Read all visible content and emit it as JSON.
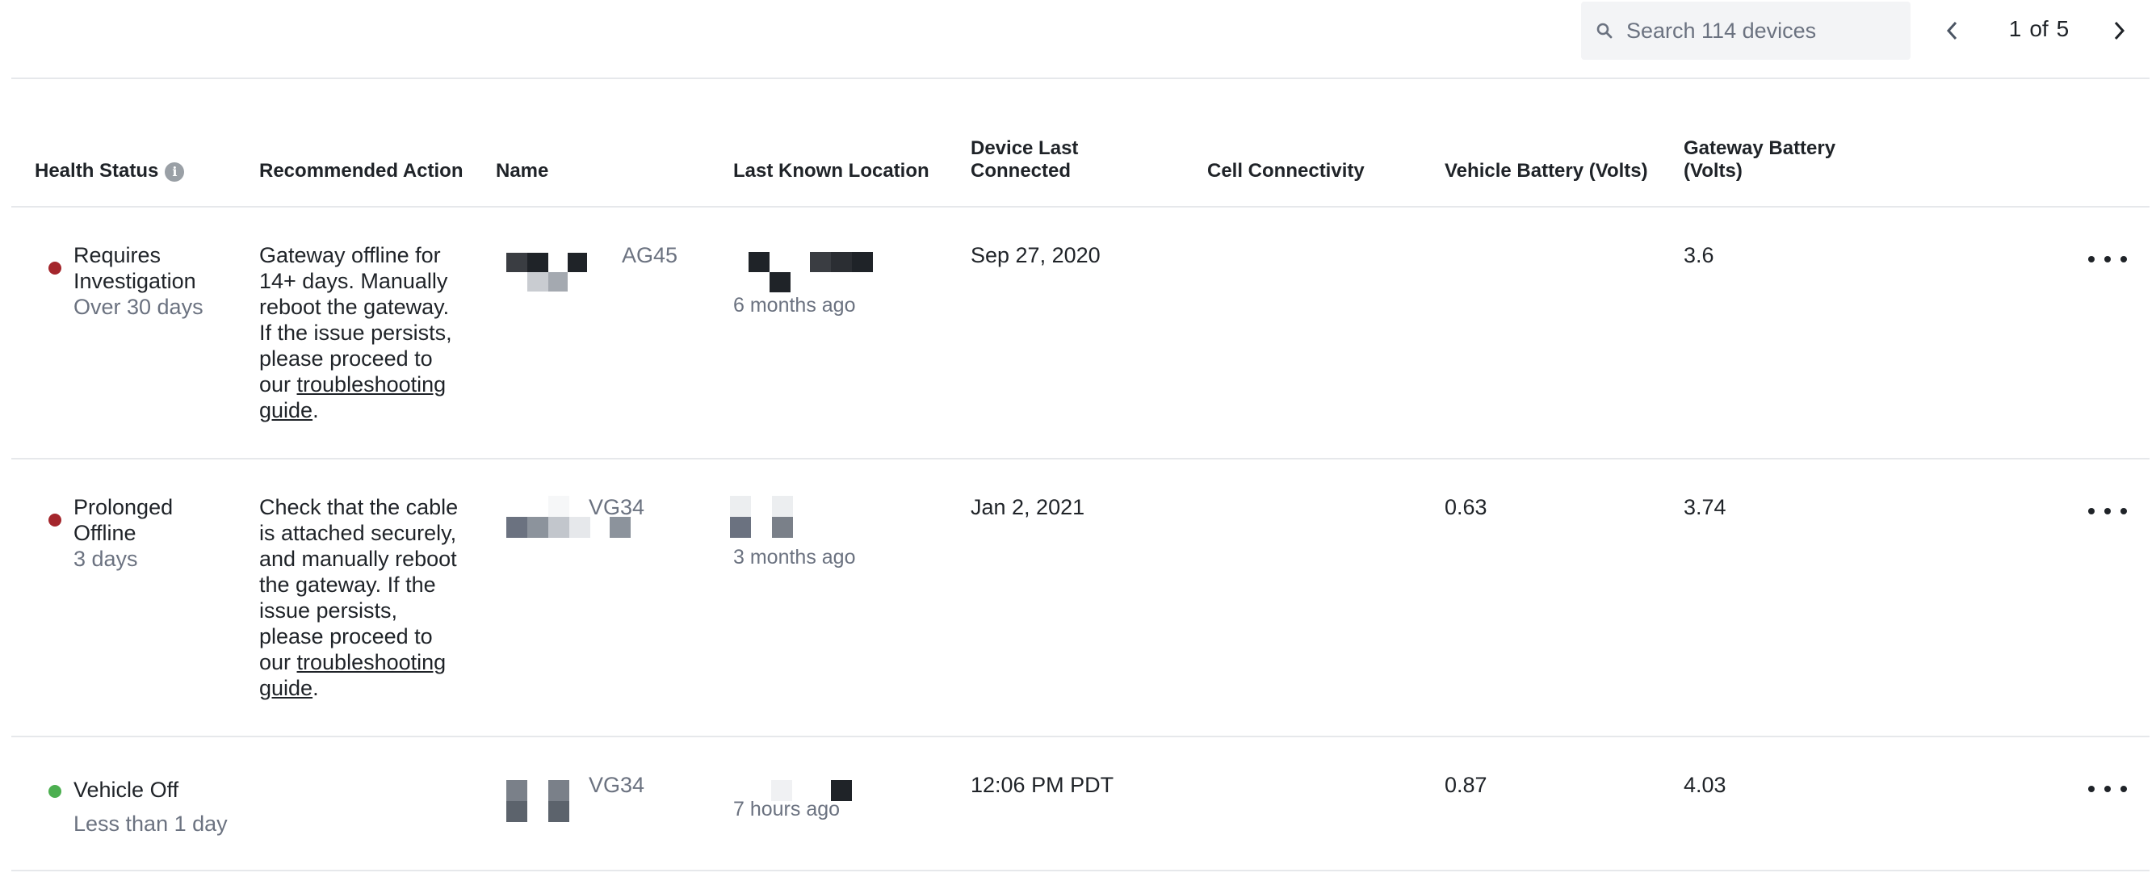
{
  "search": {
    "placeholder": "Search 114 devices",
    "value": ""
  },
  "pager": {
    "current": "1",
    "of": "of",
    "total": "5"
  },
  "columns": {
    "health_status": "Health Status",
    "recommended_action": "Recommended Action",
    "name": "Name",
    "last_known_location": "Last Known Location",
    "device_last_connected_1": "Device Last",
    "device_last_connected_2": "Connected",
    "cell_connectivity": "Cell Connectivity",
    "vehicle_battery": "Vehicle Battery (Volts)",
    "gateway_battery_1": "Gateway Battery",
    "gateway_battery_2": "(Volts)"
  },
  "colors": {
    "status_red": "#a4262c",
    "status_green": "#4caf50"
  },
  "rows": [
    {
      "status": "Requires",
      "status_2": "Investigation",
      "status_duration": "Over 30 days",
      "status_color": "red",
      "action_lines": [
        "Gateway offline for",
        "14+ days. Manually",
        "reboot the gateway.",
        "If the issue persists,",
        "please proceed to"
      ],
      "action_link_prefix": "our ",
      "action_link_1": "troubleshooting",
      "action_link_2": "guide",
      "action_suffix": ".",
      "name_tag": "AG45",
      "location_time": "6 months ago",
      "last_connected": "Sep 27, 2020",
      "cell_connectivity": "",
      "vehicle_battery": "",
      "gateway_battery": "3.6"
    },
    {
      "status": "Prolonged",
      "status_2": "Offline",
      "status_duration": "3 days",
      "status_color": "red",
      "action_lines": [
        "Check that the cable",
        "is attached securely,",
        "and manually reboot",
        "the gateway. If the",
        "issue persists,",
        "please proceed to"
      ],
      "action_link_prefix": "our ",
      "action_link_1": "troubleshooting",
      "action_link_2": "guide",
      "action_suffix": ".",
      "name_tag": "VG34",
      "location_time": "3 months ago",
      "last_connected": "Jan 2, 2021",
      "cell_connectivity": "",
      "vehicle_battery": "0.63",
      "gateway_battery": "3.74"
    },
    {
      "status": "Vehicle Off",
      "status_duration": "Less than 1 day",
      "status_color": "green",
      "name_tag": "VG34",
      "location_time": "7 hours ago",
      "last_connected": "12:06 PM PDT",
      "cell_connectivity": "",
      "vehicle_battery": "0.87",
      "gateway_battery": "4.03"
    }
  ]
}
